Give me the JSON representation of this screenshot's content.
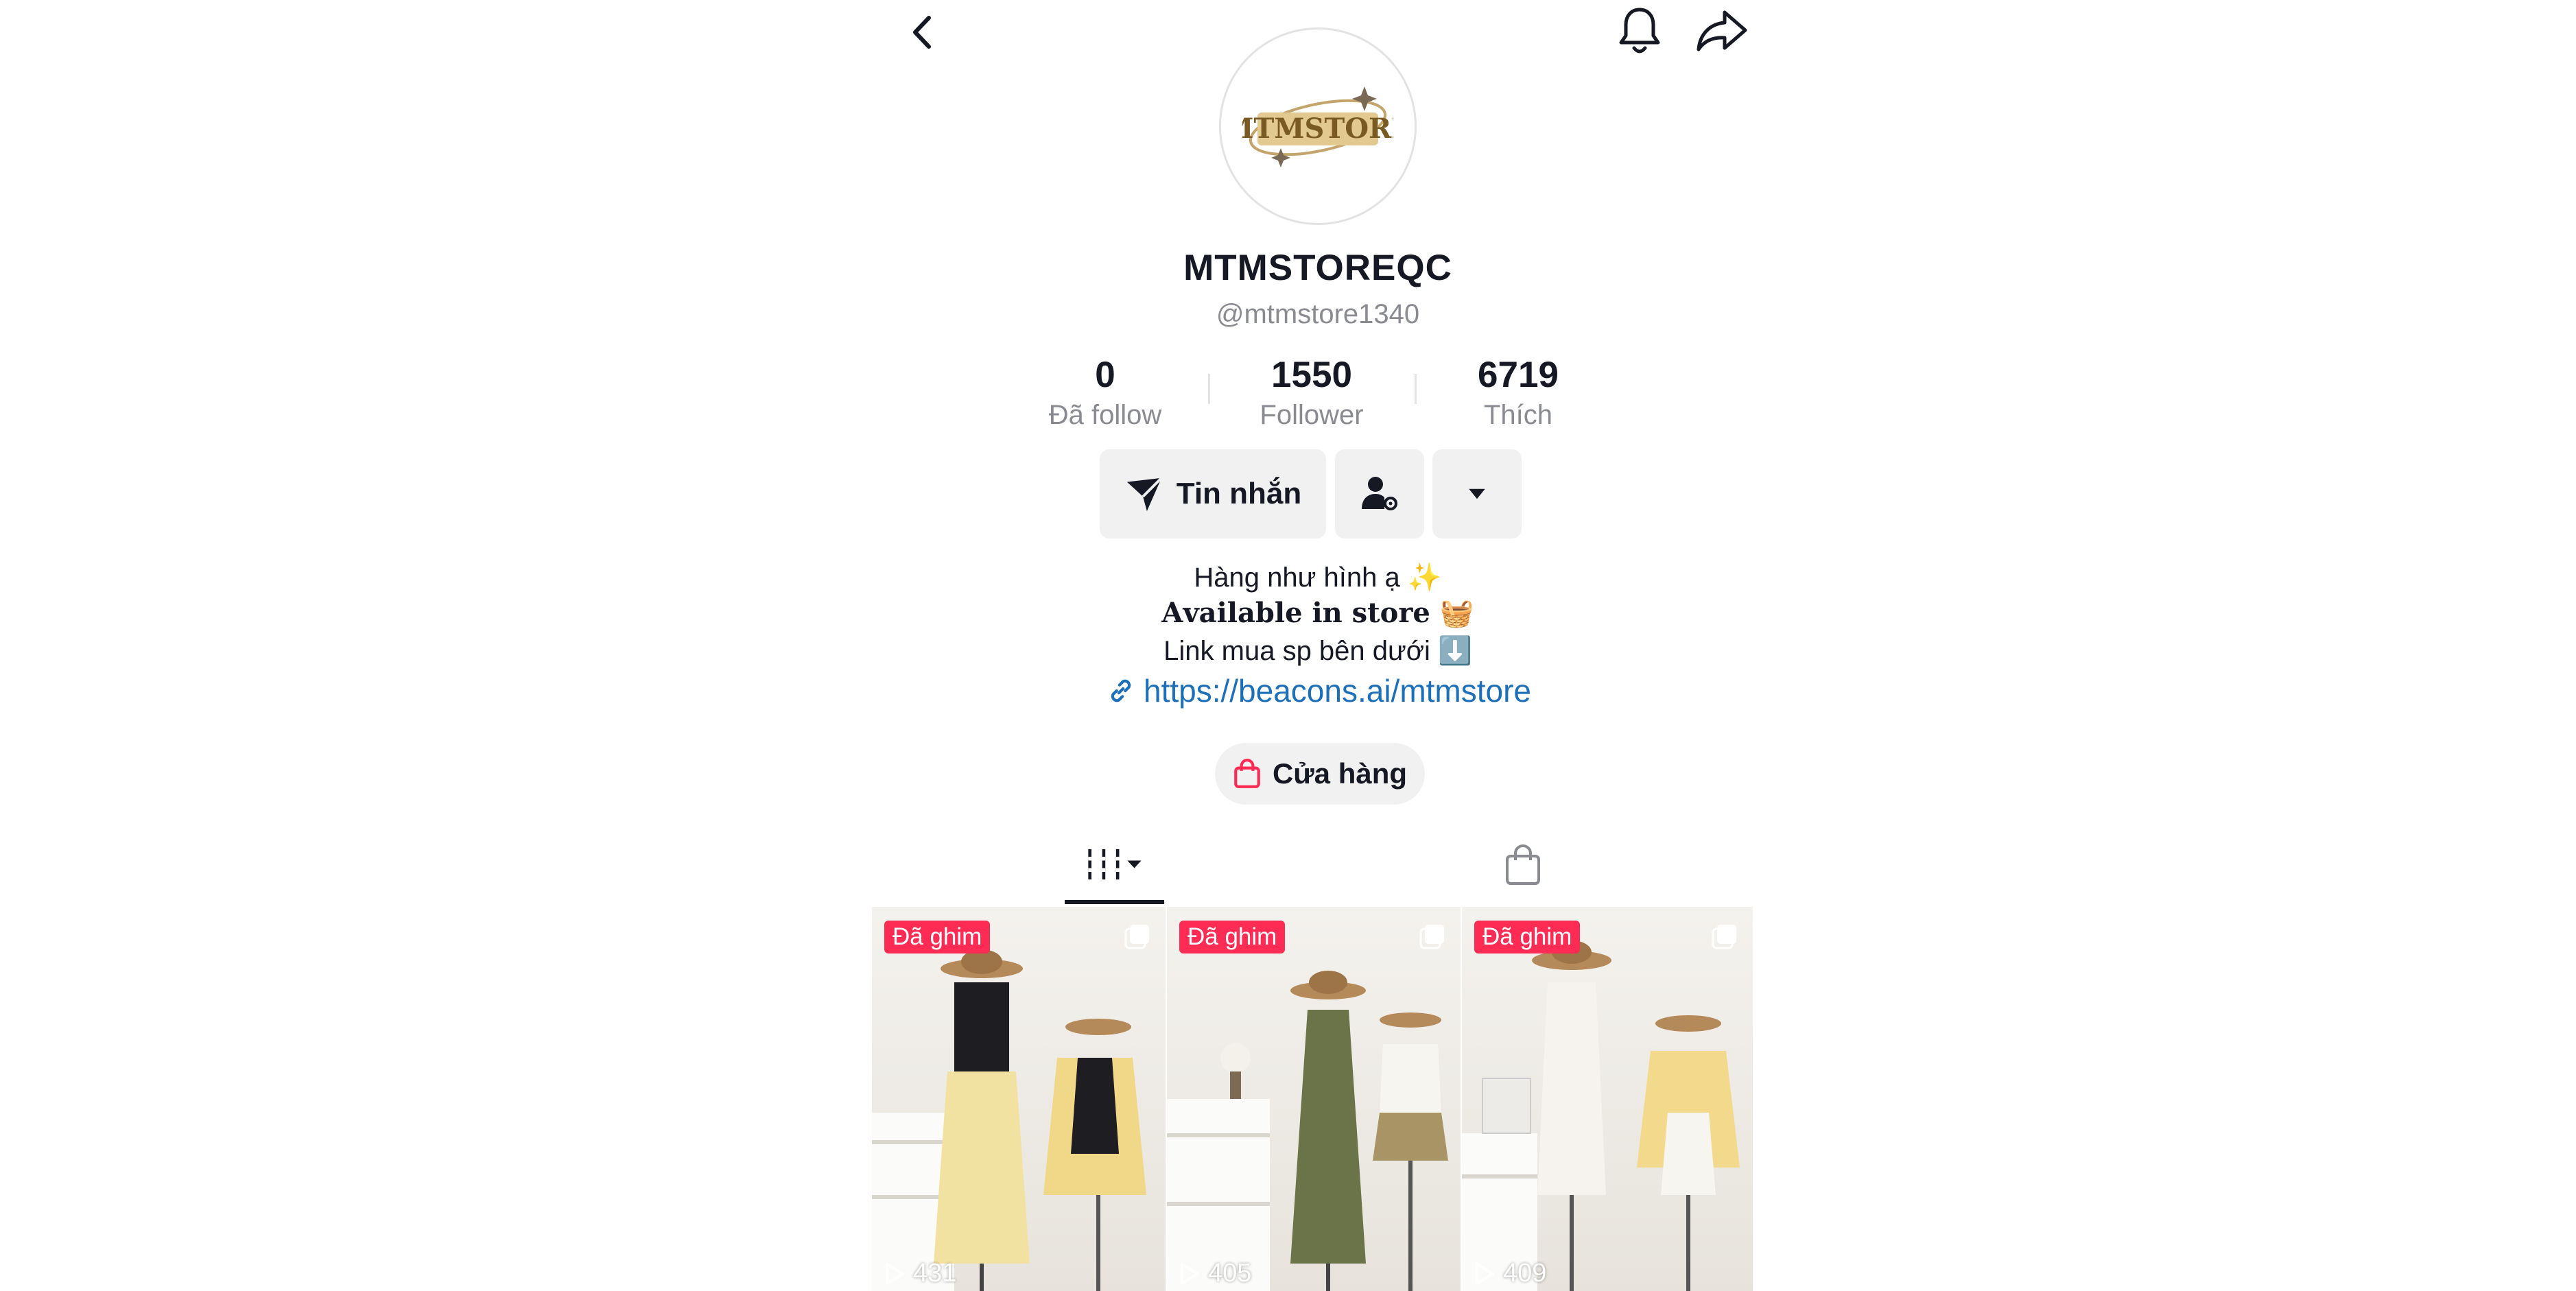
{
  "profile": {
    "display_name": "MTMSTOREQC",
    "handle": "@mtmstore1340",
    "logo_text": "MTMSTORE"
  },
  "stats": [
    {
      "value": "0",
      "label": "Đã follow"
    },
    {
      "value": "1550",
      "label": "Follower"
    },
    {
      "value": "6719",
      "label": "Thích"
    }
  ],
  "actions": {
    "message_label": "Tin nhắn"
  },
  "bio": {
    "line1": "Hàng như hình ạ ✨",
    "line2": "𝐀𝐯𝐚𝐢𝐥𝐚𝐛𝐥𝐞 𝐢𝐧 𝐬𝐭𝐨𝐫𝐞 🧺",
    "line3": "Link mua sp bên dưới ⬇️",
    "link": "https://beacons.ai/mtmstore"
  },
  "shop_button_label": "Cửa hàng",
  "videos": [
    {
      "badge": "Đã ghim",
      "views": "431"
    },
    {
      "badge": "Đã ghim",
      "views": "405"
    },
    {
      "badge": "Đã ghim",
      "views": "409"
    }
  ],
  "colors": {
    "pinned_badge": "#fe2c55",
    "link": "#1d6fb8",
    "button_bg": "#f1f1f2",
    "shop_icon": "#fe2c55"
  },
  "icons": [
    "back-icon",
    "bell-icon",
    "share-icon",
    "send-icon",
    "user-settings-icon",
    "caret-down-icon",
    "link-icon",
    "shopping-bag-icon",
    "grid-videos-icon",
    "shop-tab-icon",
    "multi-photo-icon",
    "play-icon"
  ]
}
